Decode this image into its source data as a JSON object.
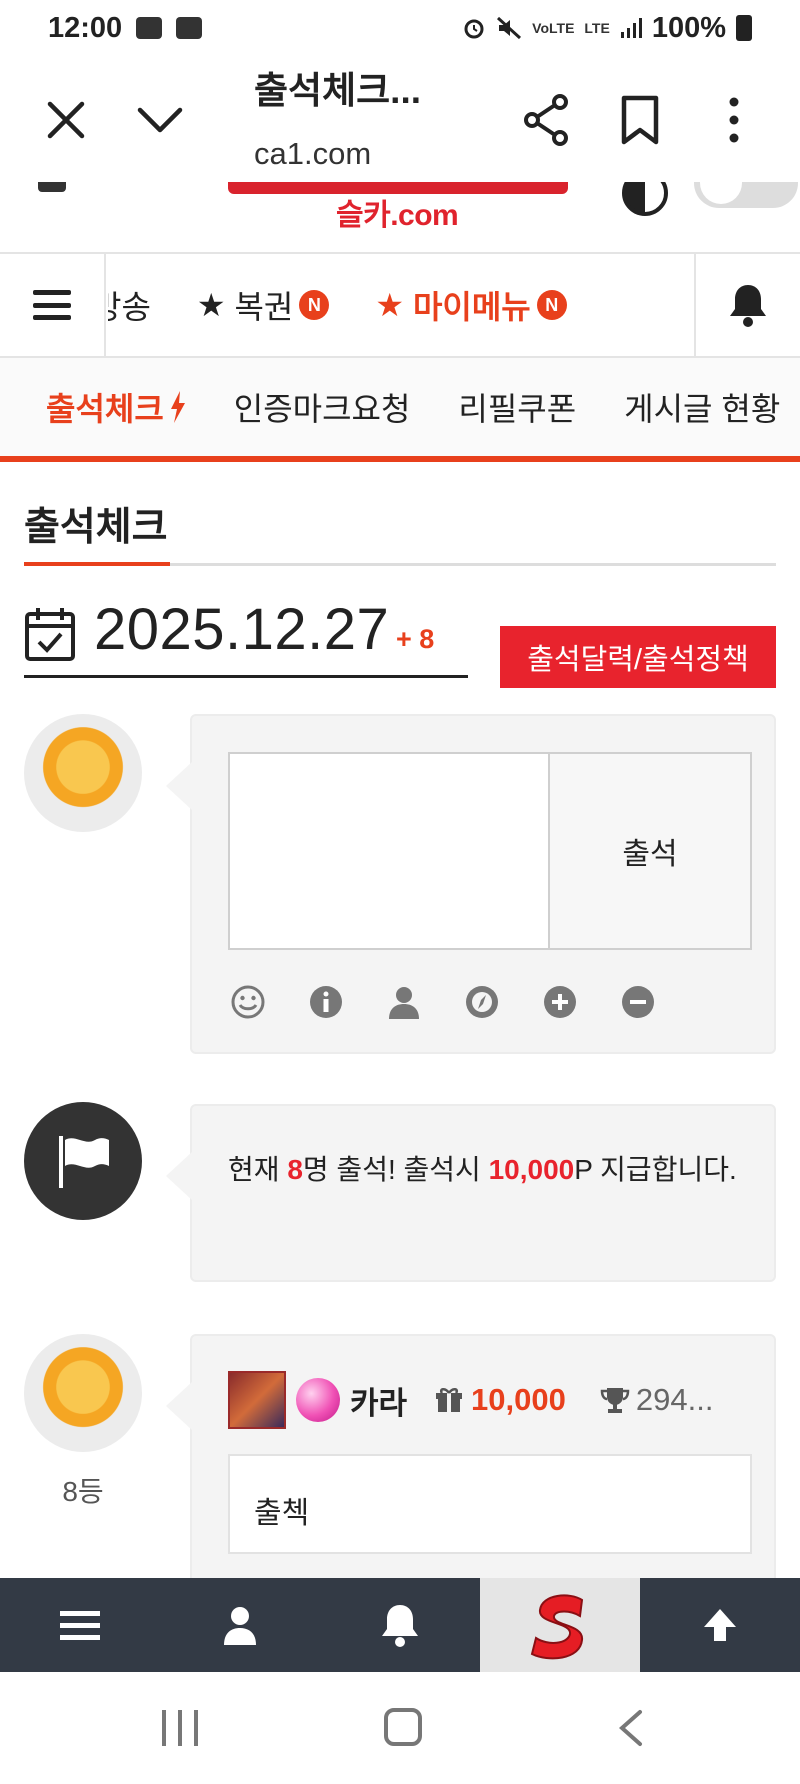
{
  "status_bar": {
    "time": "12:00",
    "volte": "VoLTE",
    "lte": "LTE",
    "battery": "100%"
  },
  "browser": {
    "title": "출석체크...",
    "url": "ca1.com"
  },
  "site_logo": {
    "text": "슬카.com"
  },
  "main_nav": {
    "items": [
      {
        "label": "방송",
        "prefix": "",
        "badge": ""
      },
      {
        "label": "복권",
        "prefix": "★",
        "badge": "N"
      },
      {
        "label": "마이메뉴",
        "prefix": "★",
        "badge": "N"
      }
    ]
  },
  "sub_tabs": [
    {
      "label": "출석체크"
    },
    {
      "label": "인증마크요청"
    },
    {
      "label": "리필쿠폰"
    },
    {
      "label": "게시글 현황"
    }
  ],
  "page": {
    "title": "출석체크"
  },
  "date_row": {
    "date": "2025.12.27",
    "plus": "+ 8",
    "policy_button": "출석달력/출석정책"
  },
  "attend_form": {
    "input_value": "",
    "submit_label": "출석"
  },
  "notice": {
    "prefix": "현재 ",
    "count": "8",
    "middle": "명 출석! 출석시 ",
    "points": "10,000",
    "suffix": "P 지급합니다."
  },
  "comment": {
    "name": "카라",
    "points": "10,000",
    "rank_score": "294...",
    "body": "출첵",
    "rank_label": "8등"
  },
  "colors": {
    "accent": "#e8401c",
    "red_button": "#e8232d",
    "bottom_bar": "#333a45"
  }
}
